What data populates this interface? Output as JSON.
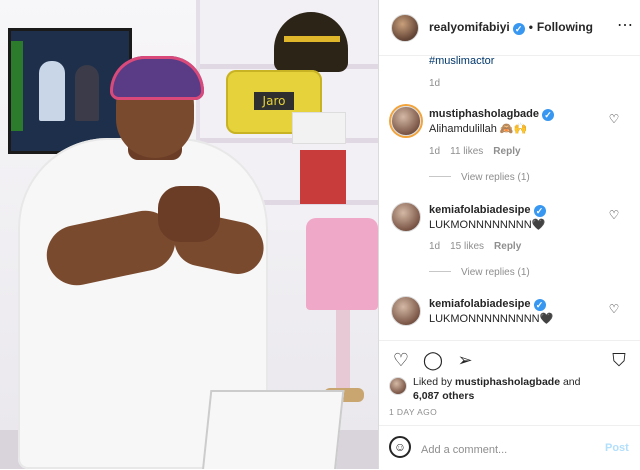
{
  "post": {
    "author": "realyomifabiyi",
    "follow_status": "Following",
    "hashtag": "#muslimactor",
    "caption_time": "1d",
    "likes_text_prefix": "Liked by",
    "likes_user": "mustiphasholagbade",
    "likes_text_mid": "and",
    "likes_count": "6,087 others",
    "date": "1 DAY AGO"
  },
  "comments": [
    {
      "user": "mustiphasholagbade",
      "verified": true,
      "text": "Alihamdulillah 🙈🙌",
      "time": "1d",
      "likes": "11 likes",
      "reply": "Reply",
      "view_replies": "View replies (1)"
    },
    {
      "user": "kemiafolabiadesipe",
      "verified": true,
      "text": "LUKMONNNNNNNN🖤",
      "time": "1d",
      "likes": "15 likes",
      "reply": "Reply",
      "view_replies": "View replies (1)"
    },
    {
      "user": "kemiafolabiadesipe",
      "verified": true,
      "text": "LUKMONNNNNNNNN🖤"
    }
  ],
  "photo": {
    "pillow_label": "Jaro"
  },
  "add_comment": {
    "placeholder": "Add a comment...",
    "post_label": "Post"
  },
  "icons": {
    "more": "more-options-icon",
    "like": "heart-icon",
    "comment": "comment-bubble-icon",
    "share": "share-icon",
    "save": "bookmark-icon",
    "emoji": "emoji-icon"
  },
  "colors": {
    "verified": "#3897f0",
    "link": "#00376b",
    "muted": "#8e8e8e",
    "post_disabled": "#b2dffc"
  }
}
